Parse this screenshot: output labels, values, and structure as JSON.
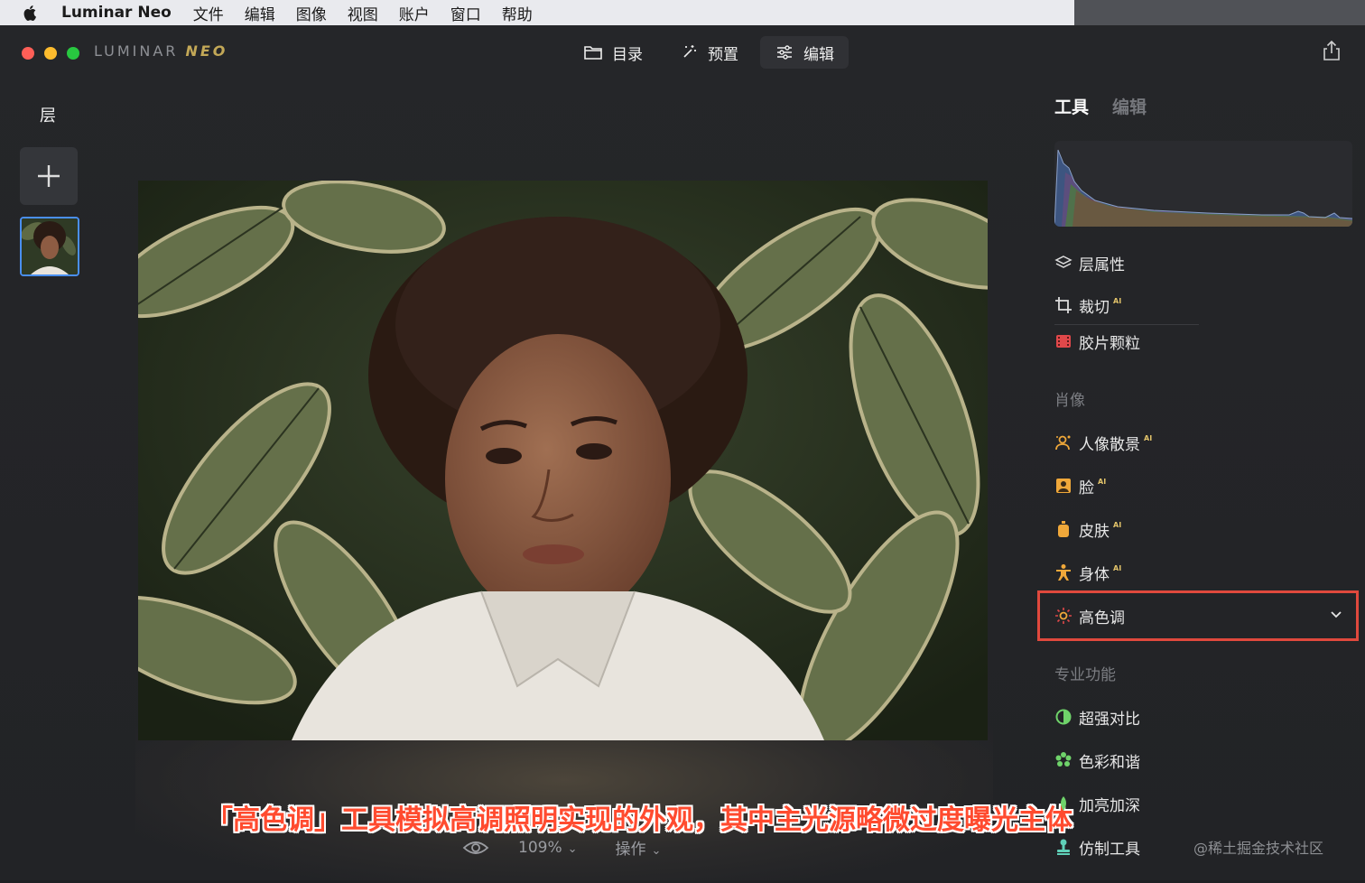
{
  "menubar": {
    "app_name": "Luminar Neo",
    "items": [
      "文件",
      "编辑",
      "图像",
      "视图",
      "账户",
      "窗口",
      "帮助"
    ]
  },
  "window": {
    "logo_main": "LUMINAR",
    "logo_accent": "NEO",
    "tabs": [
      {
        "label": "目录",
        "icon": "folder-icon",
        "active": false
      },
      {
        "label": "预置",
        "icon": "magic-wand-icon",
        "active": false
      },
      {
        "label": "编辑",
        "icon": "sliders-icon",
        "active": true
      }
    ]
  },
  "left_panel": {
    "title": "层"
  },
  "bottom_bar": {
    "zoom": "109%",
    "actions": "操作"
  },
  "right_panel": {
    "tabs": [
      {
        "label": "工具",
        "active": true
      },
      {
        "label": "编辑",
        "active": false
      }
    ],
    "tools_top": [
      {
        "label": "层属性",
        "icon": "layers-icon",
        "ai": false
      },
      {
        "label": "裁切",
        "icon": "crop-icon",
        "ai": true
      },
      {
        "label": "胶片颗粒",
        "icon": "film-icon",
        "ai": false
      }
    ],
    "section_portrait": "肖像",
    "tools_portrait": [
      {
        "label": "人像散景",
        "icon": "portrait-bokeh-icon",
        "ai": true
      },
      {
        "label": "脸",
        "icon": "face-icon",
        "ai": true
      },
      {
        "label": "皮肤",
        "icon": "skin-icon",
        "ai": true
      },
      {
        "label": "身体",
        "icon": "body-icon",
        "ai": true
      },
      {
        "label": "高色调",
        "icon": "high-key-icon",
        "ai": false,
        "selected": true
      }
    ],
    "section_pro": "专业功能",
    "tools_pro": [
      {
        "label": "超强对比",
        "icon": "contrast-icon",
        "ai": false
      },
      {
        "label": "色彩和谐",
        "icon": "color-harmony-icon",
        "ai": false
      },
      {
        "label": "加亮加深",
        "icon": "dodge-burn-icon",
        "ai": false
      },
      {
        "label": "仿制工具",
        "icon": "clone-stamp-icon",
        "ai": false
      }
    ],
    "ai_badge": "AI"
  },
  "overlay": {
    "subtitle": "「高色调」工具模拟高调照明实现的外观，其中主光源略微过度曝光主体",
    "watermark": "@稀土掘金技术社区"
  },
  "colors": {
    "accent_blue": "#4a8ff0",
    "highlight_red": "#e0493d",
    "ai_gold": "#e2c36a",
    "subtitle_red": "#ff4b2f"
  }
}
